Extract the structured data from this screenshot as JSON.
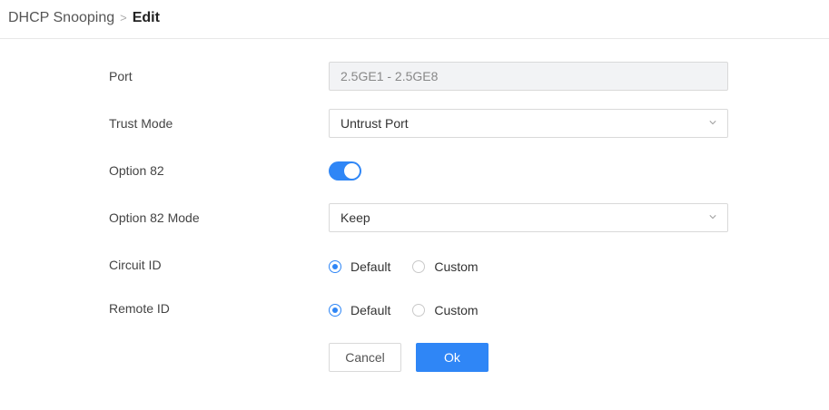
{
  "breadcrumb": {
    "parent": "DHCP Snooping",
    "separator": ">",
    "current": "Edit"
  },
  "form": {
    "port": {
      "label": "Port",
      "value": "2.5GE1 - 2.5GE8"
    },
    "trust_mode": {
      "label": "Trust Mode",
      "value": "Untrust Port"
    },
    "option82": {
      "label": "Option 82",
      "enabled": true
    },
    "option82_mode": {
      "label": "Option 82 Mode",
      "value": "Keep"
    },
    "circuit_id": {
      "label": "Circuit ID",
      "options": [
        "Default",
        "Custom"
      ],
      "selected": "Default"
    },
    "remote_id": {
      "label": "Remote ID",
      "options": [
        "Default",
        "Custom"
      ],
      "selected": "Default"
    }
  },
  "buttons": {
    "cancel": "Cancel",
    "ok": "Ok"
  },
  "colors": {
    "accent": "#2f86f6",
    "disabled_bg": "#f2f3f5",
    "border": "#d9d9d9"
  }
}
